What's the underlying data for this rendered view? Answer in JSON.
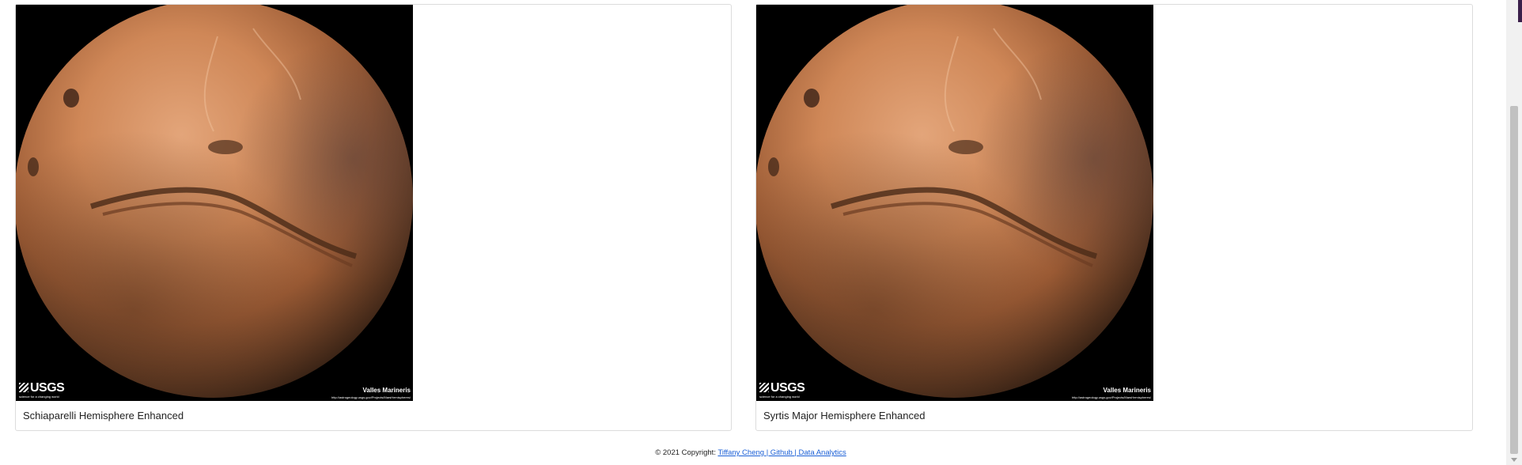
{
  "hemispheres": [
    {
      "title": "Schiaparelli Hemisphere Enhanced",
      "image_overlay": {
        "logo_text": "USGS",
        "logo_tagline": "science for a changing world",
        "region_name": "Valles Marineris",
        "source_url": "http://astrogeology.usgs.gov/Projects/MarsHemispheres/"
      }
    },
    {
      "title": "Syrtis Major Hemisphere Enhanced",
      "image_overlay": {
        "logo_text": "USGS",
        "logo_tagline": "science for a changing world",
        "region_name": "Valles Marineris",
        "source_url": "http://astrogeology.usgs.gov/Projects/MarsHemispheres/"
      }
    }
  ],
  "footer": {
    "copyright": "© 2021 Copyright:",
    "link_text": "Tiffany Cheng | Github | Data Analytics"
  },
  "colors": {
    "link": "#1a5fd6",
    "card_border": "#dcdcdc",
    "mars_light": "#d9915f",
    "mars_dark": "#3b2416"
  },
  "icons": {
    "scroll_down": "chevron-down-icon"
  }
}
